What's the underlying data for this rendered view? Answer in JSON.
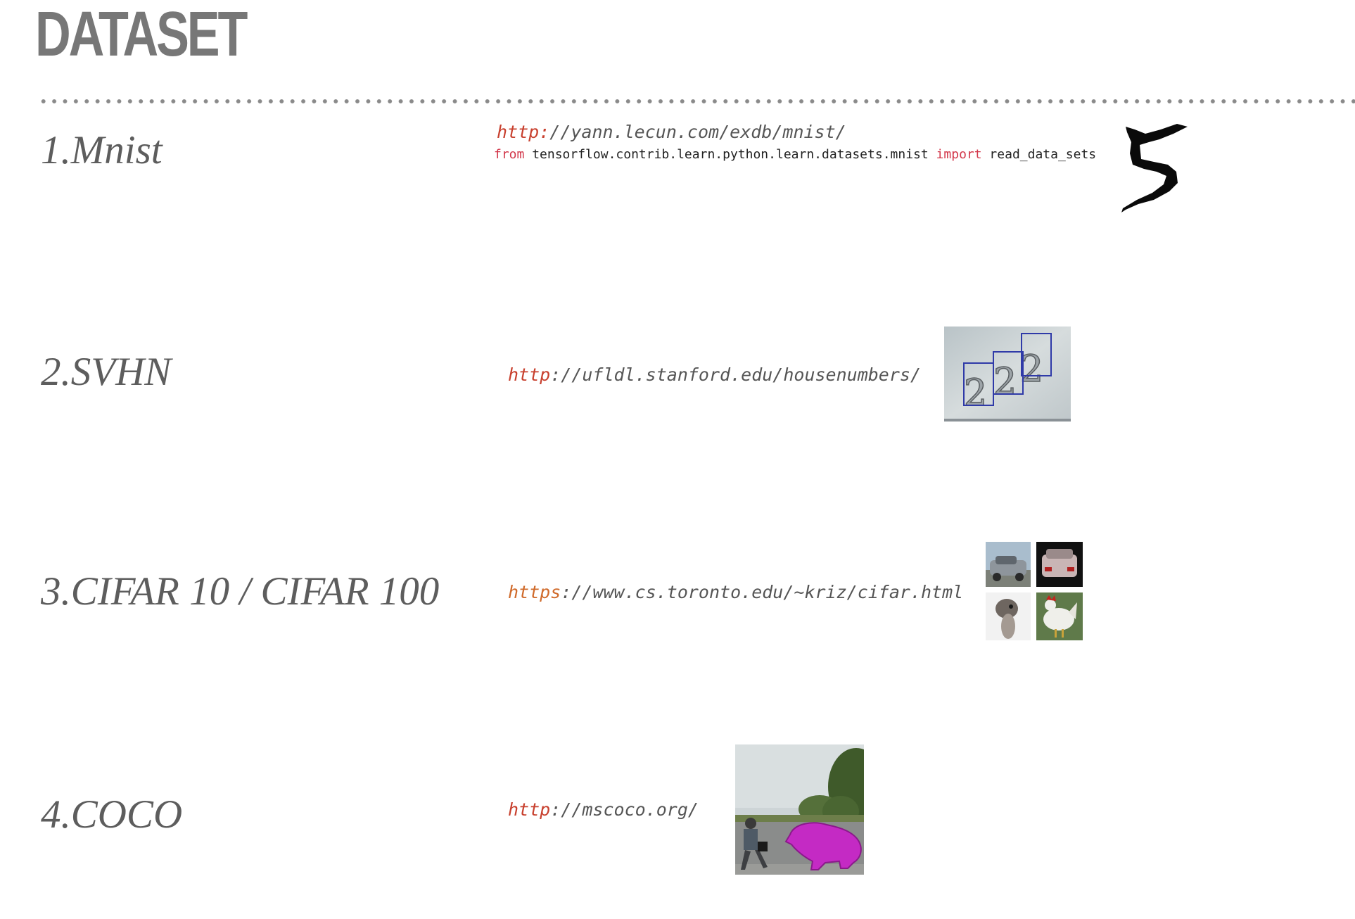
{
  "title": "DATASET",
  "datasets": [
    {
      "name": "1.Mnist",
      "url_scheme": "http:",
      "url_rest": "//yann.lecun.com/exdb/mnist/",
      "code": {
        "kw_from": "from",
        "module": " tensorflow.contrib.learn.python.learn.datasets.mnist ",
        "kw_import": "import",
        "symbol": " read_data_sets"
      },
      "thumbnail": "handwritten-digit-5-image"
    },
    {
      "name": "2.SVHN",
      "url_scheme": "http",
      "url_rest": "://ufldl.stanford.edu/housenumbers/",
      "thumbnail": "house-number-image"
    },
    {
      "name": "3.CIFAR 10 / CIFAR 100",
      "url_scheme": "https",
      "url_rest": "://www.cs.toronto.edu/~kriz/cifar.html",
      "thumbnail": "cifar-sample-grid"
    },
    {
      "name": "4.COCO",
      "url_scheme": "http",
      "url_rest": "://mscoco.org/",
      "thumbnail": "coco-segmentation-image"
    }
  ],
  "colors": {
    "title": "#777777",
    "text": "#5d5d5d",
    "url_scheme": "#c8402e",
    "keyword": "#d2374a"
  }
}
